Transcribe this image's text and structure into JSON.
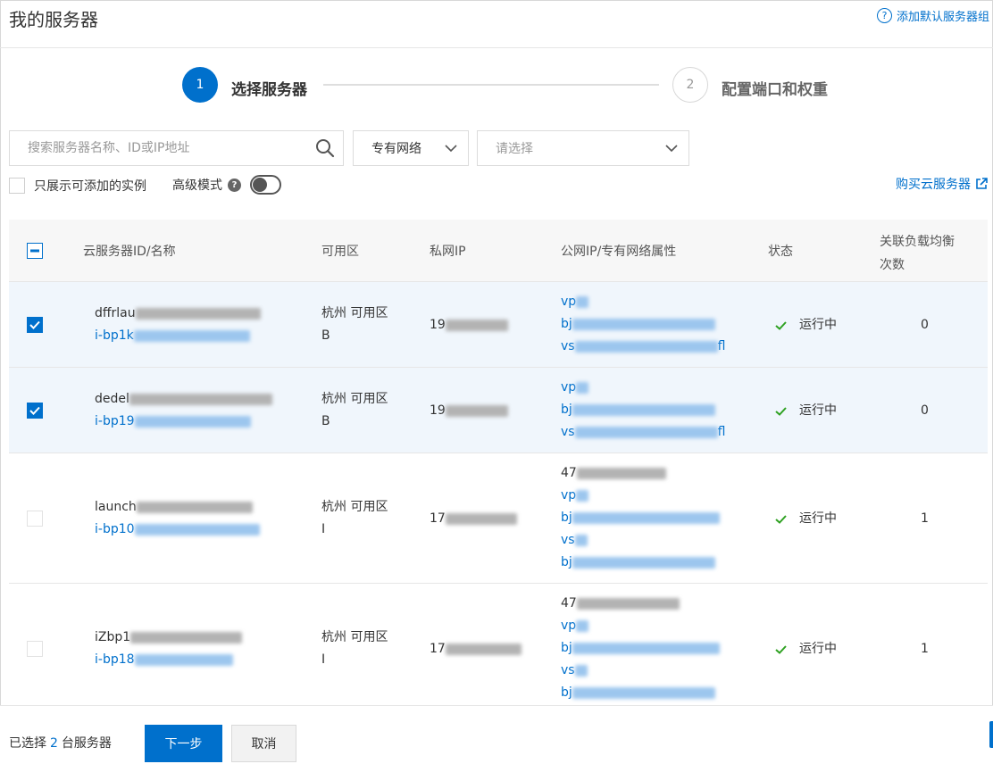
{
  "header": {
    "title": "我的服务器",
    "help_icon": "question-circle-icon",
    "help_link": "添加默认服务器组"
  },
  "steps": [
    {
      "number": "1",
      "label": "选择服务器",
      "state": "active"
    },
    {
      "number": "2",
      "label": "配置端口和权重",
      "state": "inactive"
    }
  ],
  "filters": {
    "search_placeholder": "搜索服务器名称、ID或IP地址",
    "network_type": "专有网络",
    "vpc_placeholder": "请选择"
  },
  "options": {
    "only_available": "只展示可添加的实例",
    "advanced_mode": "高级模式",
    "advanced_mode_on": false,
    "buy_link": "购买云服务器"
  },
  "table": {
    "headers": {
      "name": "云服务器ID/名称",
      "zone": "可用区",
      "private_ip": "私网IP",
      "public_ip": "公网IP/专有网络属性",
      "status": "状态",
      "lb_count_1": "关联负载均衡",
      "lb_count_2": "次数"
    },
    "rows": [
      {
        "checked": true,
        "name": "dffrlau",
        "id": "i-bp1k",
        "zone_1": "杭州 可用区",
        "zone_2": "B",
        "private_ip": "19",
        "public": [
          "vp",
          "bj",
          "vs"
        ],
        "public_suffix": "fl",
        "status": "运行中",
        "count": "0"
      },
      {
        "checked": true,
        "name": "dedel",
        "id": "i-bp19",
        "zone_1": "杭州 可用区",
        "zone_2": "B",
        "private_ip": "19",
        "public": [
          "vp",
          "bj",
          "vs"
        ],
        "public_suffix": "fl",
        "status": "运行中",
        "count": "0"
      },
      {
        "checked": false,
        "name": "launch",
        "id": "i-bp10",
        "zone_1": "杭州 可用区",
        "zone_2": "I",
        "private_ip": "17",
        "public_ip": "47",
        "public": [
          "vp",
          "bj",
          "vs",
          "bj"
        ],
        "status": "运行中",
        "count": "1"
      },
      {
        "checked": false,
        "name": "iZbp1",
        "id": "i-bp18",
        "zone_1": "杭州 可用区",
        "zone_2": "I",
        "private_ip": "17",
        "public_ip": "47",
        "public": [
          "vp",
          "bj",
          "vs",
          "bj"
        ],
        "status": "运行中",
        "count": "1"
      }
    ]
  },
  "footer": {
    "selected_prefix": "已选择",
    "selected_count": "2",
    "selected_suffix": "台服务器",
    "next_button": "下一步",
    "cancel_button": "取消"
  },
  "colors": {
    "primary": "#0070cc",
    "success": "#2ea121",
    "selected_row": "#f0f6fc"
  }
}
